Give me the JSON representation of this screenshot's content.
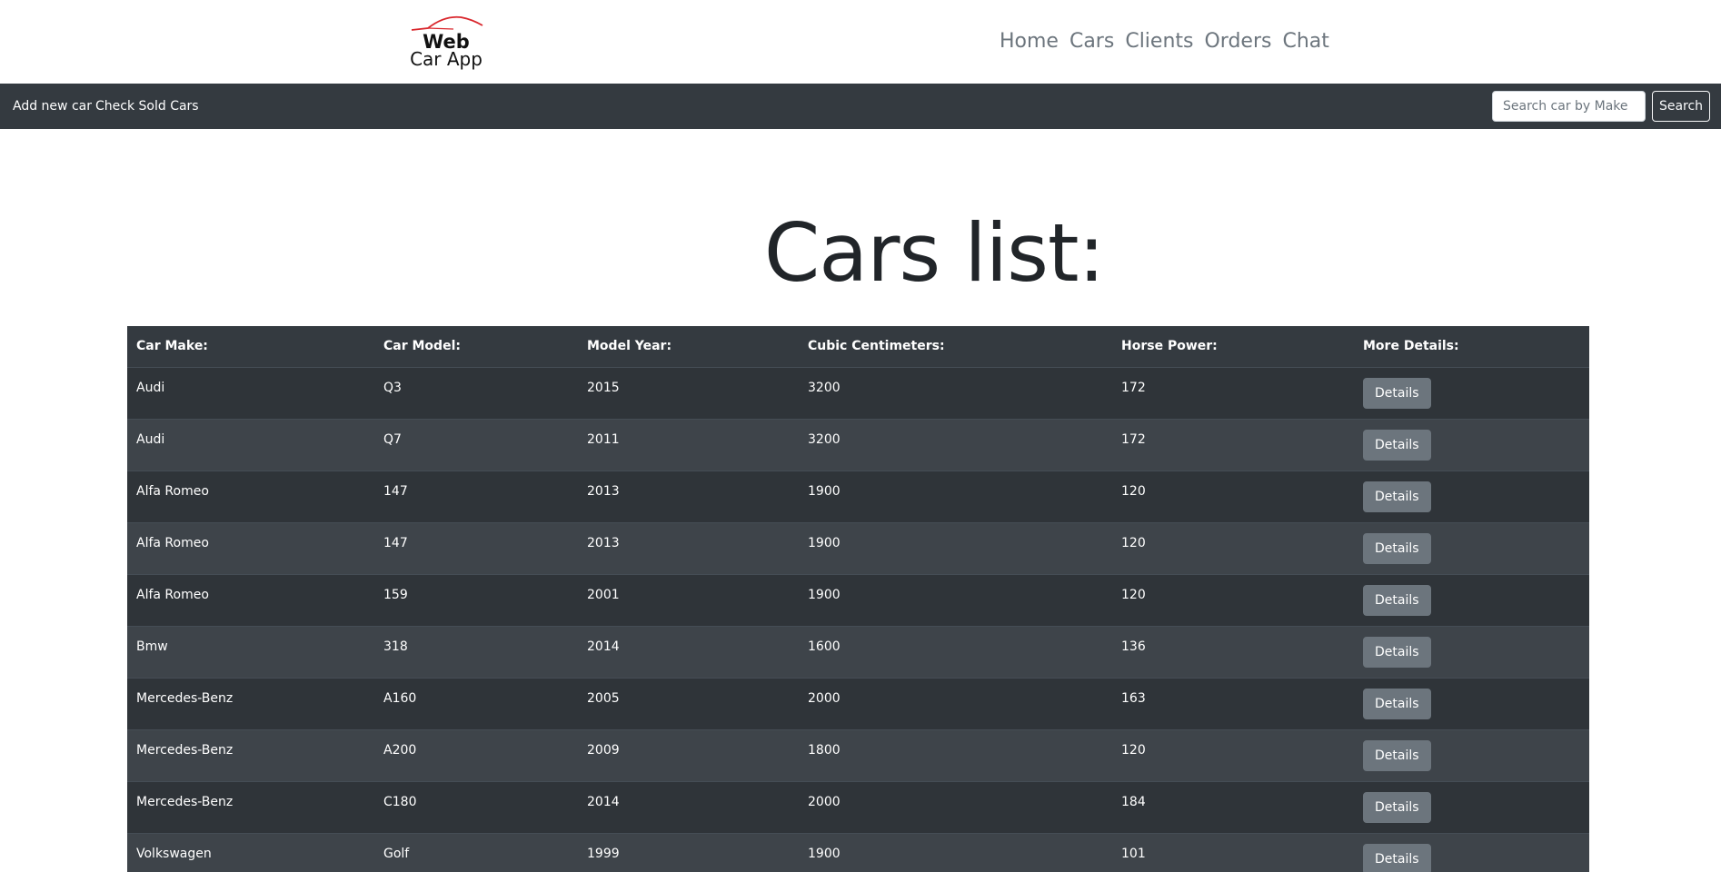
{
  "logo": {
    "line1": "Web",
    "line2": "Car App",
    "accent_color": "#d9262c"
  },
  "nav": {
    "items": [
      "Home",
      "Cars",
      "Clients",
      "Orders",
      "Chat"
    ]
  },
  "toolbar": {
    "add_new_car": "Add new car",
    "check_sold_cars": "Check Sold Cars",
    "search_placeholder": "Search car by Make",
    "search_value": "",
    "search_button": "Search"
  },
  "page_title": "Cars list:",
  "table": {
    "headers": [
      "Car Make:",
      "Car Model:",
      "Model Year:",
      "Cubic Centimeters:",
      "Horse Power:",
      "More Details:"
    ],
    "details_label": "Details",
    "rows": [
      [
        "Audi",
        "Q3",
        "2015",
        "3200",
        "172"
      ],
      [
        "Audi",
        "Q7",
        "2011",
        "3200",
        "172"
      ],
      [
        "Alfa Romeo",
        "147",
        "2013",
        "1900",
        "120"
      ],
      [
        "Alfa Romeo",
        "147",
        "2013",
        "1900",
        "120"
      ],
      [
        "Alfa Romeo",
        "159",
        "2001",
        "1900",
        "120"
      ],
      [
        "Bmw",
        "318",
        "2014",
        "1600",
        "136"
      ],
      [
        "Mercedes-Benz",
        "A160",
        "2005",
        "2000",
        "163"
      ],
      [
        "Mercedes-Benz",
        "A200",
        "2009",
        "1800",
        "120"
      ],
      [
        "Mercedes-Benz",
        "C180",
        "2014",
        "2000",
        "184"
      ],
      [
        "Volkswagen",
        "Golf",
        "1999",
        "1900",
        "101"
      ]
    ]
  },
  "colors": {
    "toolbar_bg": "#343a40",
    "row_odd": "#2f3439",
    "row_even": "#3e444a",
    "button_secondary": "#6c757d",
    "nav_link": "#6c757d"
  }
}
